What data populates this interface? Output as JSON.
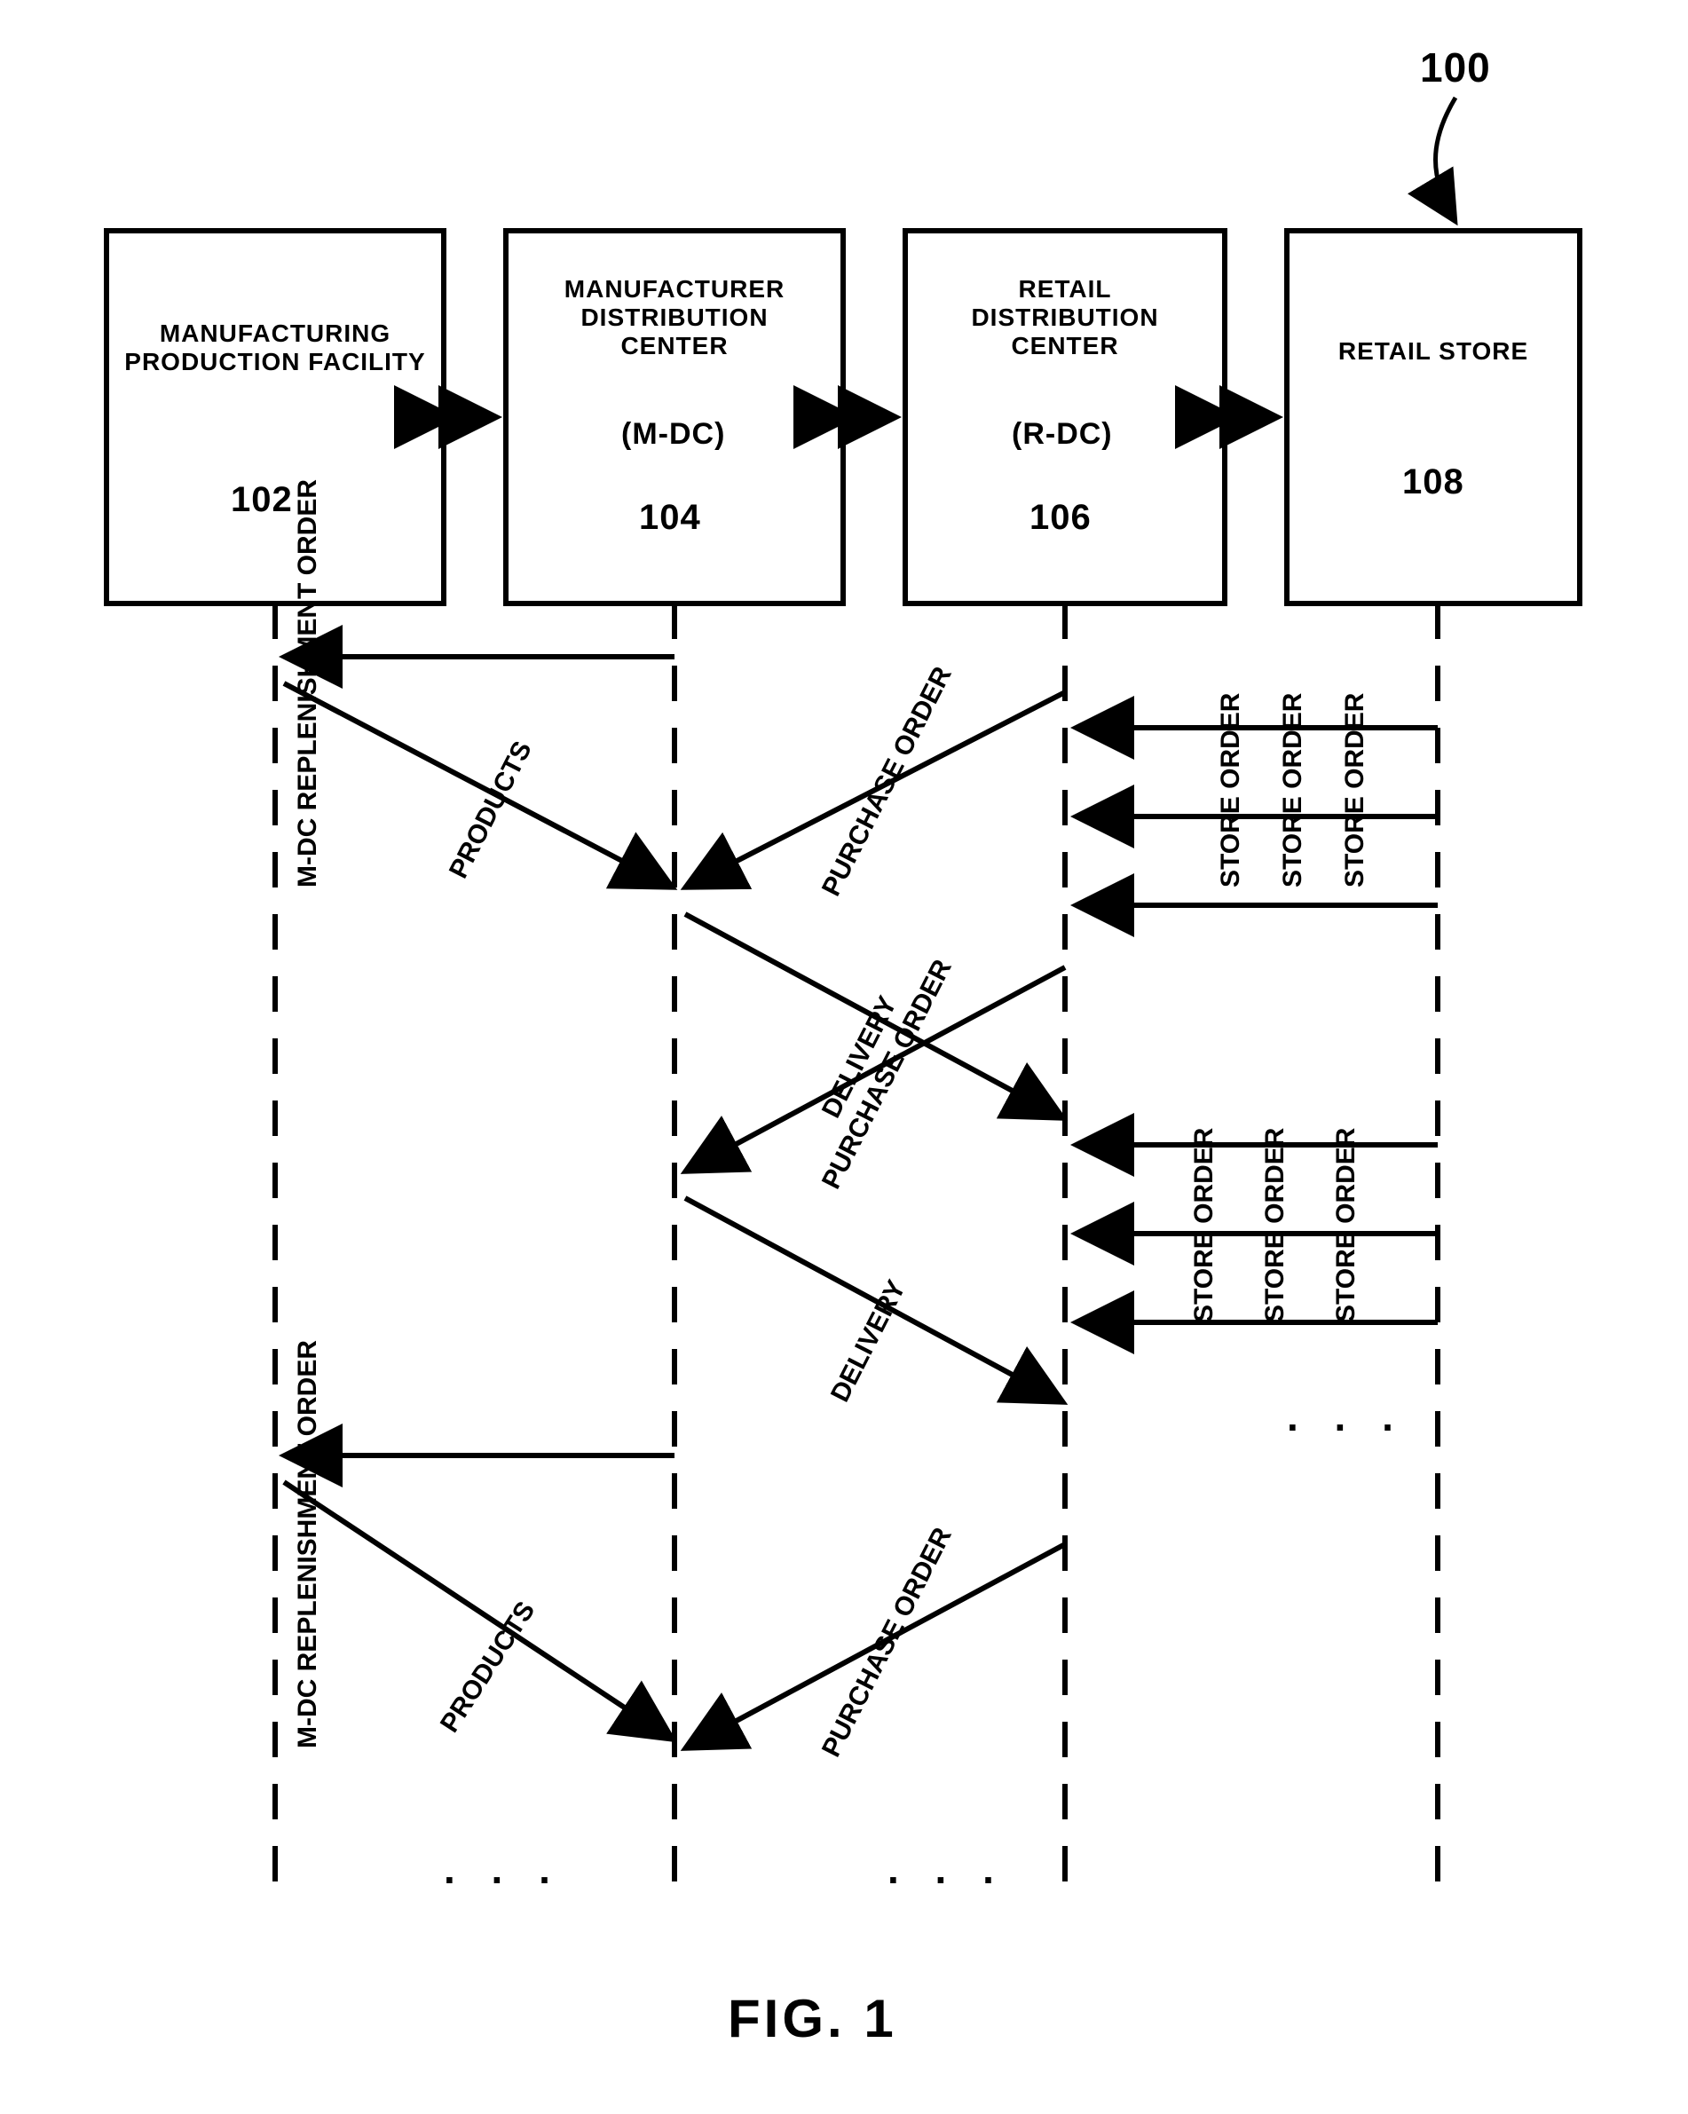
{
  "figure_ref": "100",
  "figure_label": "FIG. 1",
  "boxes": {
    "b1": {
      "title": "MANUFACTURING PRODUCTION FACILITY",
      "ref": "102"
    },
    "b2": {
      "title": "MANUFACTURER DISTRIBUTION CENTER",
      "acronym": "(M-DC)",
      "ref": "104"
    },
    "b3": {
      "title": "RETAIL DISTRIBUTION CENTER",
      "acronym": "(R-DC)",
      "ref": "106"
    },
    "b4": {
      "title": "RETAIL STORE",
      "ref": "108"
    }
  },
  "labels": {
    "mdc_replen": "M-DC REPLENISHMENT ORDER",
    "products": "PRODUCTS",
    "purchase_order": "PURCHASE ORDER",
    "delivery": "DELIVERY",
    "store_order": "STORE ORDER",
    "ellipsis": ". . ."
  }
}
